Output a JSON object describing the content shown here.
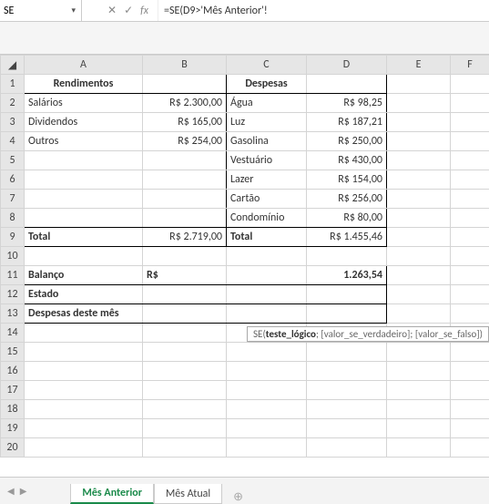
{
  "formula_bar": {
    "name_box": "SE",
    "formula": "=SE(D9>'Mês Anterior'!"
  },
  "headers": {
    "A": "A",
    "B": "B",
    "C": "C",
    "D": "D",
    "E": "E",
    "F": "F"
  },
  "row_count": 20,
  "titles": {
    "rendimentos": "Rendimentos",
    "despesas": "Despesas"
  },
  "rendimentos": [
    {
      "label": "Salários",
      "value": "R$  2.300,00"
    },
    {
      "label": "Dividendos",
      "value": "R$     165,00"
    },
    {
      "label": "Outros",
      "value": "R$     254,00"
    }
  ],
  "despesas": [
    {
      "label": "Água",
      "value": "R$       98,25"
    },
    {
      "label": "Luz",
      "value": "R$     187,21"
    },
    {
      "label": "Gasolina",
      "value": "R$     250,00"
    },
    {
      "label": "Vestuário",
      "value": "R$     430,00"
    },
    {
      "label": "Lazer",
      "value": "R$     154,00"
    },
    {
      "label": "Cartão",
      "value": "R$     256,00"
    },
    {
      "label": "Condomínio",
      "value": "R$       80,00"
    }
  ],
  "totals": {
    "rend_label": "Total",
    "rend_value": "R$  2.719,00",
    "desp_label": "Total",
    "desp_value": "R$  1.455,46"
  },
  "summary": {
    "balanço_label": "Balanço",
    "balanço_prefix": "R$",
    "balanço_value": "1.263,54",
    "estado_label": "Estado",
    "despmes_label": "Despesas deste mês"
  },
  "tooltip": {
    "fn": "SE",
    "arg_bold": "teste_lógico",
    "arg2": "[valor_se_verdadeiro]",
    "arg3": "[valor_se_falso]"
  },
  "tabs": {
    "prev": "Mês Anterior",
    "curr": "Mês Atual"
  },
  "chart_data": {
    "type": "table",
    "title": "Monthly budget worksheet",
    "rendimentos": {
      "Salários": 2300.0,
      "Dividendos": 165.0,
      "Outros": 254.0,
      "Total": 2719.0
    },
    "despesas": {
      "Água": 98.25,
      "Luz": 187.21,
      "Gasolina": 250.0,
      "Vestuário": 430.0,
      "Lazer": 154.0,
      "Cartão": 256.0,
      "Condomínio": 80.0,
      "Total": 1455.46
    },
    "balanço": 1263.54
  }
}
